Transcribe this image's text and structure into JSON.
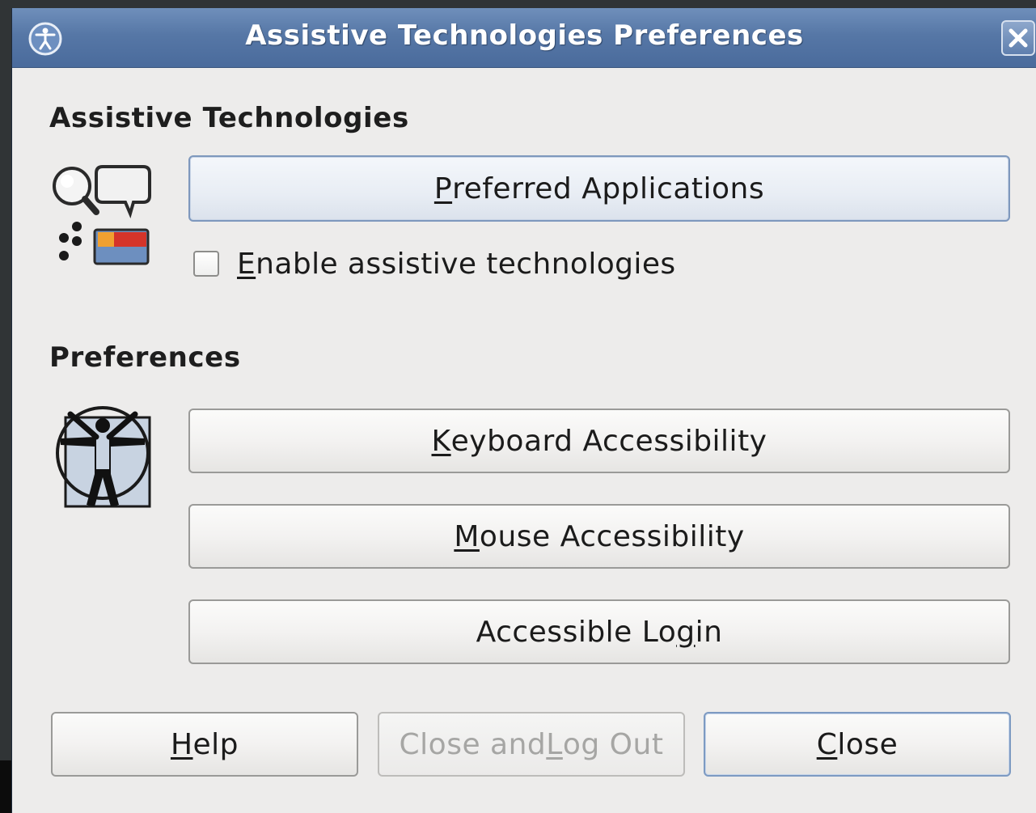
{
  "window": {
    "title": "Assistive Technologies Preferences"
  },
  "sections": {
    "assistive": {
      "heading": "Assistive Technologies",
      "preferred_apps": {
        "label_mnemonic": "P",
        "label_rest": "referred Applications"
      },
      "enable_checkbox": {
        "label_mnemonic": "E",
        "label_rest": "nable assistive technologies",
        "checked": false
      }
    },
    "preferences": {
      "heading": "Preferences",
      "keyboard": {
        "label_mnemonic": "K",
        "label_rest": "eyboard Accessibility"
      },
      "mouse": {
        "label_mnemonic": "M",
        "label_rest": "ouse Accessibility"
      },
      "login": {
        "label_pre": "Accessible Lo",
        "label_mnemonic": "g",
        "label_post": "in"
      }
    }
  },
  "footer": {
    "help": {
      "label_mnemonic": "H",
      "label_rest": "elp"
    },
    "close_logout": {
      "label_pre": "Close and ",
      "label_mnemonic": "L",
      "label_post": "og Out",
      "enabled": false
    },
    "close": {
      "label_mnemonic": "C",
      "label_rest": "lose"
    }
  },
  "icons": {
    "title": "accessibility-icon",
    "assistive_section": "assistive-technologies-icon",
    "preferences_section": "vitruvian-man-icon",
    "close": "close-icon"
  },
  "colors": {
    "titlebar": "#5677a6",
    "window_bg": "#edeceb",
    "disabled_text": "#a6a6a4"
  }
}
